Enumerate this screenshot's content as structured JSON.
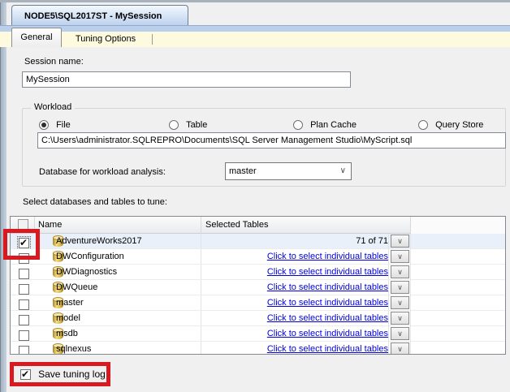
{
  "window": {
    "document_tab": "NODE5\\SQL2017ST - MySession"
  },
  "tabs": [
    {
      "label": "General",
      "selected": true
    },
    {
      "label": "Tuning Options",
      "selected": false
    }
  ],
  "session": {
    "label": "Session name:",
    "value": "MySession"
  },
  "workload": {
    "group_label": "Workload",
    "options": [
      {
        "label": "File",
        "selected": true
      },
      {
        "label": "Table",
        "selected": false
      },
      {
        "label": "Plan Cache",
        "selected": false
      },
      {
        "label": "Query Store",
        "selected": false
      }
    ],
    "file_path": "C:\\Users\\administrator.SQLREPRO\\Documents\\SQL Server Management Studio\\MyScript.sql",
    "database_label": "Database for workload analysis:",
    "database_value": "master"
  },
  "tune_section": {
    "label": "Select databases and tables to tune:",
    "columns": [
      "Name",
      "Selected Tables"
    ],
    "rows": [
      {
        "name": "AdventureWorks2017",
        "checked": true,
        "selected_tables": "71 of 71",
        "is_link": false,
        "highlighted": true
      },
      {
        "name": "DWConfiguration",
        "checked": false,
        "selected_tables": "Click to select individual tables",
        "is_link": true,
        "highlighted": false
      },
      {
        "name": "DWDiagnostics",
        "checked": false,
        "selected_tables": "Click to select individual tables",
        "is_link": true,
        "highlighted": false
      },
      {
        "name": "DWQueue",
        "checked": false,
        "selected_tables": "Click to select individual tables",
        "is_link": true,
        "highlighted": false
      },
      {
        "name": "master",
        "checked": false,
        "selected_tables": "Click to select individual tables",
        "is_link": true,
        "highlighted": false
      },
      {
        "name": "model",
        "checked": false,
        "selected_tables": "Click to select individual tables",
        "is_link": true,
        "highlighted": false
      },
      {
        "name": "msdb",
        "checked": false,
        "selected_tables": "Click to select individual tables",
        "is_link": true,
        "highlighted": false
      },
      {
        "name": "sqlnexus",
        "checked": false,
        "selected_tables": "Click to select individual tables",
        "is_link": true,
        "highlighted": false
      }
    ],
    "combo_arrow": "∨"
  },
  "footer": {
    "save_tuning_log_label": "Save tuning log",
    "checked": true
  },
  "colors": {
    "annotation_red": "#d8191f",
    "link_blue": "#0000e0",
    "row_highlight": "#e9f0fa",
    "tab_band_blue": "#b9cfec",
    "tab_row_yellow": "#fdfadf"
  }
}
